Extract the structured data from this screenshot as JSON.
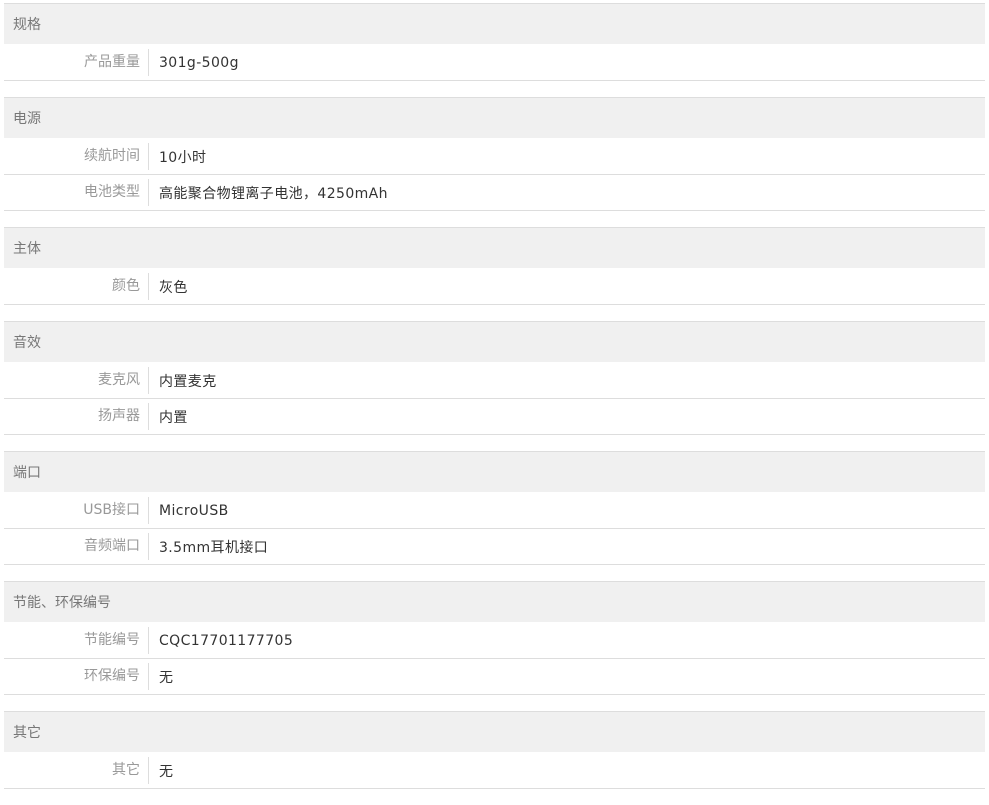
{
  "groups": [
    {
      "title": "规格",
      "rows": [
        {
          "label": "产品重量",
          "value": "301g-500g"
        }
      ]
    },
    {
      "title": "电源",
      "rows": [
        {
          "label": "续航时间",
          "value": "10小时"
        },
        {
          "label": "电池类型",
          "value": "高能聚合物锂离子电池，4250mAh"
        }
      ]
    },
    {
      "title": "主体",
      "rows": [
        {
          "label": "颜色",
          "value": "灰色"
        }
      ]
    },
    {
      "title": "音效",
      "rows": [
        {
          "label": "麦克风",
          "value": "内置麦克"
        },
        {
          "label": "扬声器",
          "value": "内置"
        }
      ]
    },
    {
      "title": "端口",
      "rows": [
        {
          "label": "USB接口",
          "value": "MicroUSB"
        },
        {
          "label": "音频端口",
          "value": "3.5mm耳机接口"
        }
      ]
    },
    {
      "title": "节能、环保编号",
      "rows": [
        {
          "label": "节能编号",
          "value": "CQC17701177705"
        },
        {
          "label": "环保编号",
          "value": "无"
        }
      ]
    },
    {
      "title": "其它",
      "rows": [
        {
          "label": "其它",
          "value": "无"
        }
      ]
    }
  ]
}
